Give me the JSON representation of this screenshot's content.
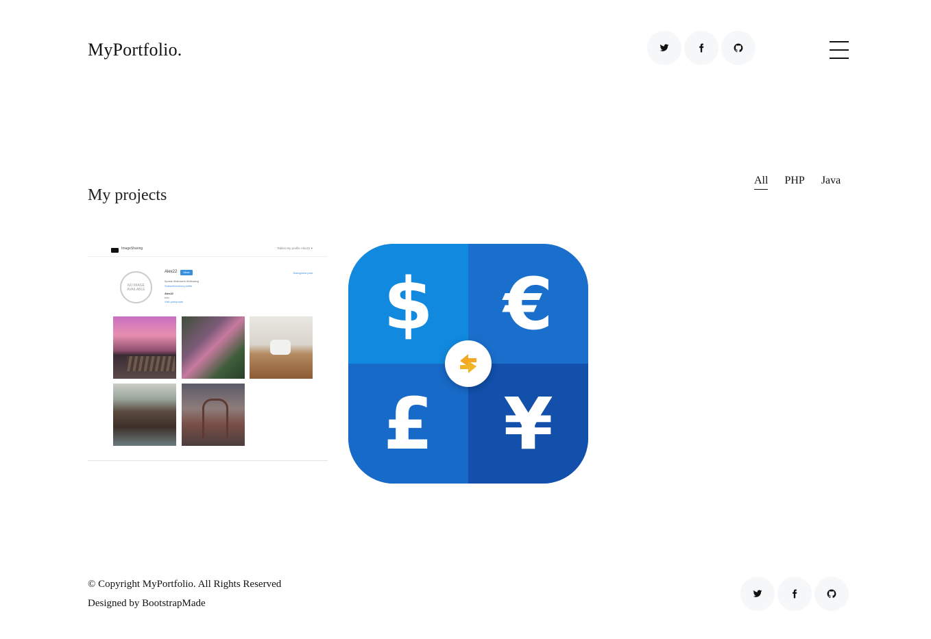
{
  "header": {
    "logo": "MyPortfolio.",
    "social": [
      "twitter-icon",
      "facebook-icon",
      "github-icon"
    ],
    "menu_icon": "hamburger-menu-icon"
  },
  "projects": {
    "title": "My projects",
    "filters": [
      {
        "label": "All",
        "active": true
      },
      {
        "label": "PHP",
        "active": false
      },
      {
        "label": "Java",
        "active": false
      }
    ],
    "items": [
      {
        "name": "image-sharing-project",
        "preview": {
          "brand": "ImageSharing",
          "nav_links": "Tables  My profile  Alex22 ▾",
          "no_image": "NO IMAGE AVAILABLE",
          "username": "Alex22",
          "follow": "follow",
          "edit_link": "Dialog/new post",
          "stats": "0posts      0followers      0following",
          "subscribe": "Subscribe/show profile",
          "name": "Alex22",
          "bio": "Info",
          "all_posts": "Visit post/posts"
        }
      },
      {
        "name": "currency-converter-project",
        "symbols": [
          "$",
          "€",
          "£",
          "¥"
        ],
        "colors": {
          "q1": "#1189de",
          "q2": "#1a6fcc",
          "q3": "#186ac8",
          "q4": "#1250ac",
          "swap": "#f5a623"
        }
      }
    ]
  },
  "footer": {
    "copyright": "© Copyright MyPortfolio. All Rights Reserved",
    "designed_prefix": "Designed by ",
    "designed_link": "BootstrapMade",
    "social": [
      "twitter-icon",
      "facebook-icon",
      "github-icon"
    ]
  }
}
